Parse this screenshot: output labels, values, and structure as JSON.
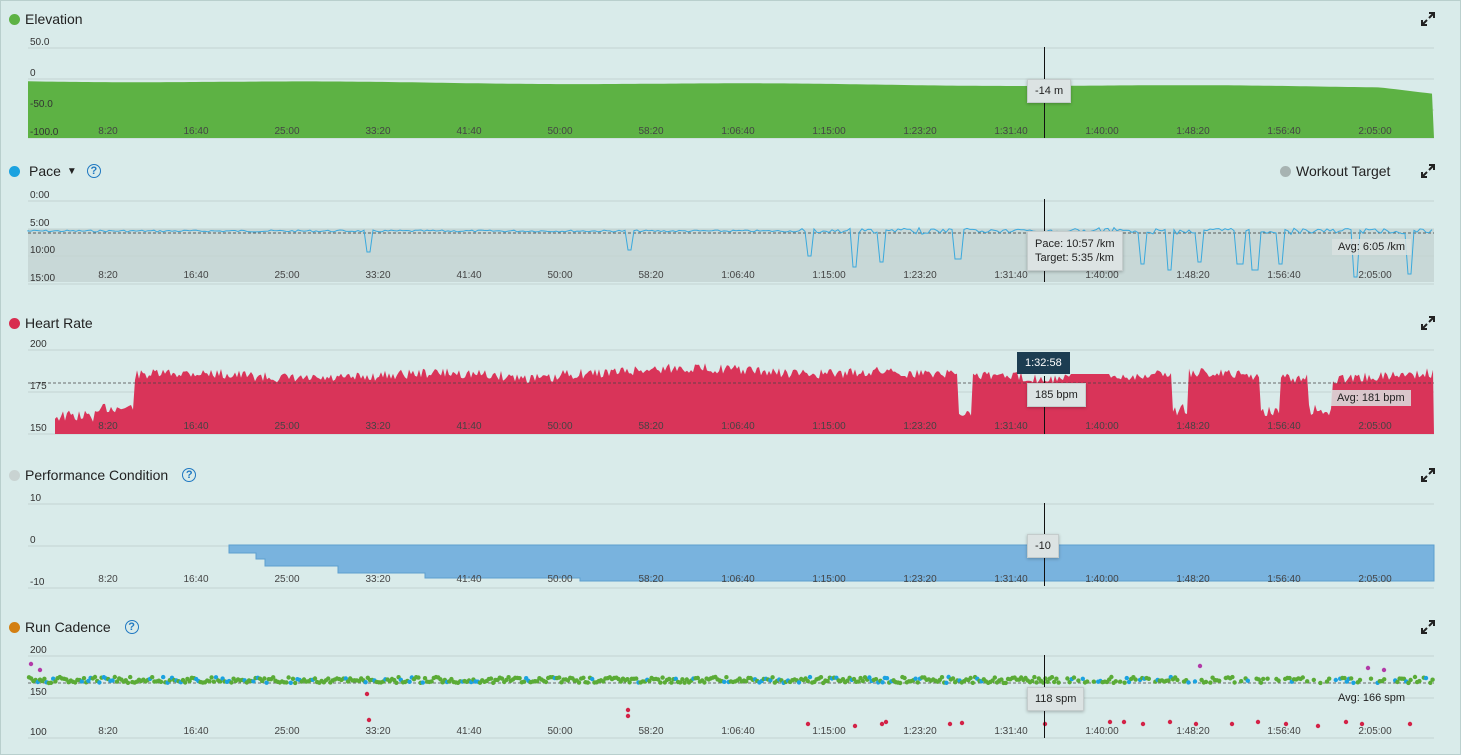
{
  "panels": {
    "elevation": {
      "title": "Elevation",
      "dot_color": "#5db244",
      "y_ticks": [
        "50.0",
        "0",
        "-50.0",
        "-100.0"
      ],
      "tooltip": "-14 m",
      "expand_icon": "expand-icon"
    },
    "pace": {
      "title": "Pace",
      "dot_color": "#1ba2e0",
      "y_ticks": [
        "0:00",
        "5:00",
        "10:00",
        "15:00"
      ],
      "legend": "Workout Target",
      "tooltip_line1": "Pace: 10:57 /km",
      "tooltip_line2": "Target: 5:35 /km",
      "avg": "Avg: 6:05 /km",
      "help": "?"
    },
    "heart_rate": {
      "title": "Heart Rate",
      "dot_color": "#d82d50",
      "y_ticks": [
        "200",
        "175",
        "150"
      ],
      "time_badge": "1:32:58",
      "tooltip": "185 bpm",
      "avg": "Avg: 181 bpm"
    },
    "performance": {
      "title": "Performance Condition",
      "dot_color": "#c9d3d2",
      "y_ticks": [
        "10",
        "0",
        "-10"
      ],
      "tooltip": "-10",
      "help": "?"
    },
    "cadence": {
      "title": "Run Cadence",
      "dot_color": "#d37f12",
      "y_ticks": [
        "200",
        "150",
        "100"
      ],
      "tooltip": "118 spm",
      "avg": "Avg: 166 spm",
      "help": "?"
    }
  },
  "x_ticks": [
    "8:20",
    "16:40",
    "25:00",
    "33:20",
    "41:40",
    "50:00",
    "58:20",
    "1:06:40",
    "1:15:00",
    "1:23:20",
    "1:31:40",
    "1:40:00",
    "1:48:20",
    "1:56:40",
    "2:05:00"
  ],
  "colors": {
    "elevation": "#5db244",
    "pace_line": "#3aa9dd",
    "heart": "#d93459",
    "performance": "#79b3de",
    "cadence_green": "#5aab36",
    "cadence_blue": "#1ba2e0",
    "cadence_red": "#d32247",
    "cadence_purple": "#b23aa8"
  }
}
